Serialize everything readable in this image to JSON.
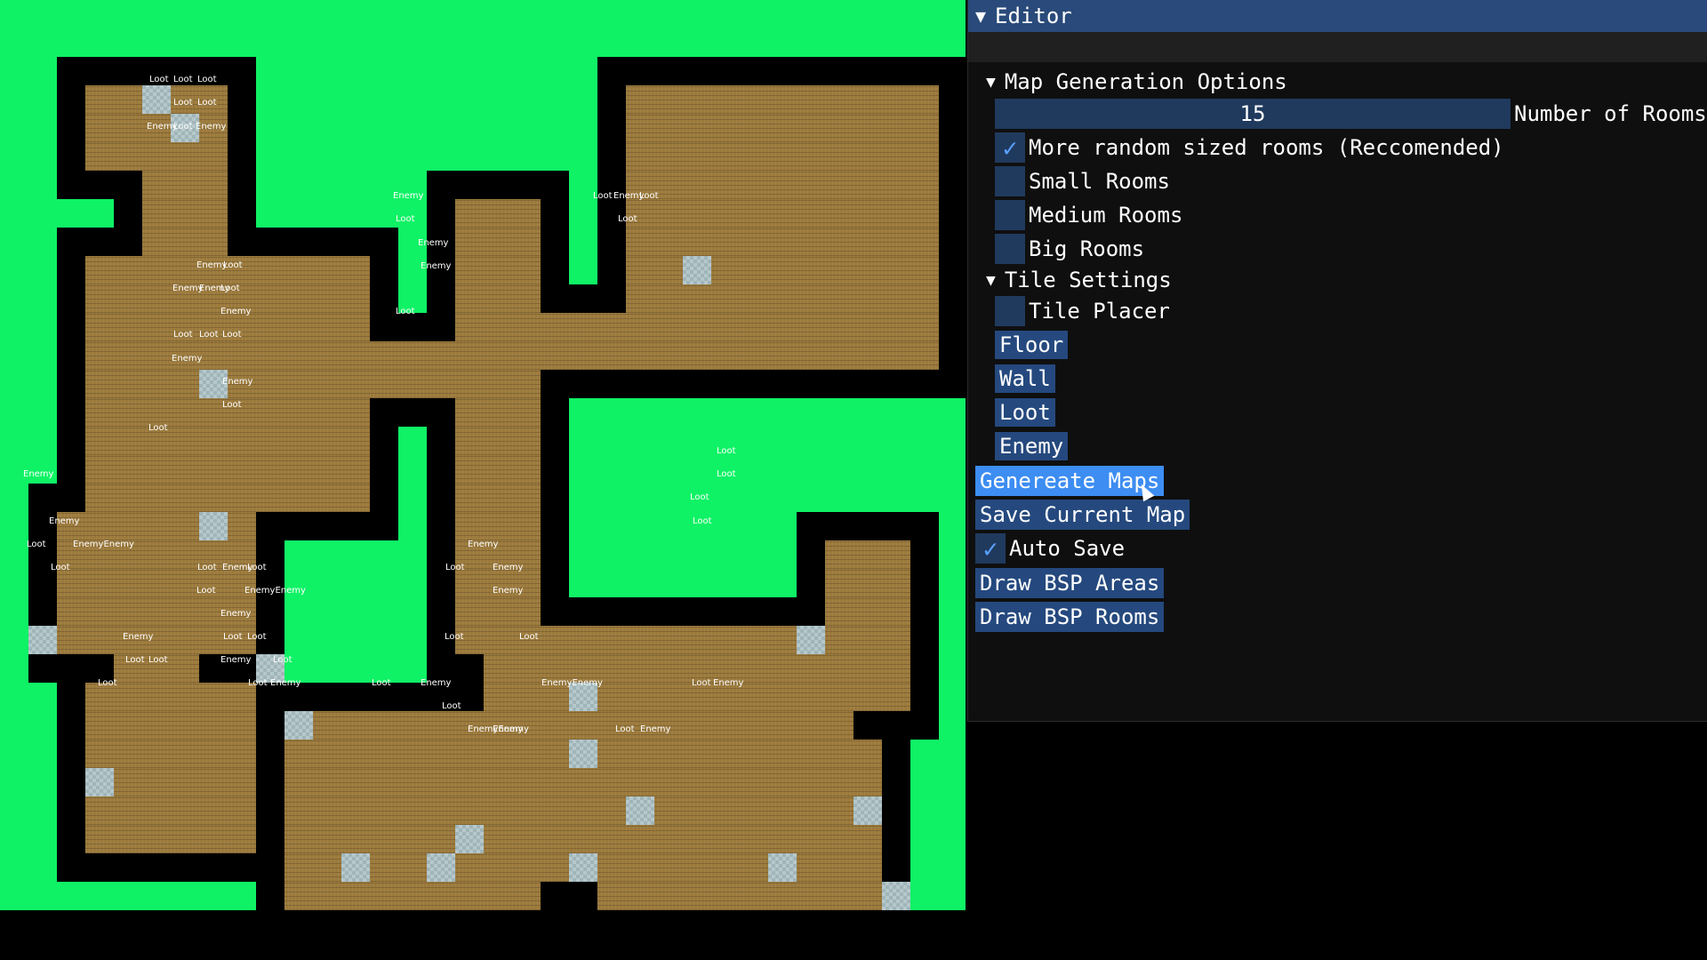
{
  "editor": {
    "title": "Editor",
    "map_generation_header": "Map Generation Options",
    "number_of_rooms_value": "15",
    "number_of_rooms_label": "Number of Rooms",
    "option_random_sized": {
      "label": "More random sized rooms (Reccomended)",
      "checked": true
    },
    "option_small_rooms": {
      "label": "Small Rooms",
      "checked": false
    },
    "option_medium_rooms": {
      "label": "Medium Rooms",
      "checked": false
    },
    "option_big_rooms": {
      "label": "Big Rooms",
      "checked": false
    },
    "tile_settings_header": "Tile Settings",
    "tile_placer": {
      "label": "Tile Placer",
      "checked": false
    },
    "tile_buttons": [
      "Floor",
      "Wall",
      "Loot",
      "Enemy"
    ],
    "generate_button": "Genereate Maps",
    "save_button": "Save Current Map",
    "auto_save": {
      "label": "Auto Save",
      "checked": true
    },
    "draw_bsp_areas_button": "Draw BSP Areas",
    "draw_bsp_rooms_button": "Draw BSP Rooms"
  },
  "map": {
    "labels": [
      "Loot",
      "Loot",
      "Loot",
      "Loot",
      "Loot",
      "Enemy",
      "Loot",
      "Enemy",
      "Enemy",
      "Loot",
      "Enemy",
      "Enemy",
      "Loot",
      "Enemy",
      "Loot",
      "Loot",
      "Enemy",
      "Loot",
      "Enemy",
      "Enemy",
      "Loot",
      "Enemy",
      "Loot",
      "Loot",
      "Loot",
      "Loot",
      "Enemy",
      "Enemy",
      "Loot",
      "Loot",
      "Loot",
      "Loot",
      "Loot",
      "Loot",
      "Enemy",
      "Loot",
      "Enemy",
      "EnemyEnemy",
      "Loot",
      "Loot",
      "Enemy",
      "Loot",
      "Enemy",
      "Loot",
      "Enemy",
      "Enemy",
      "Loot",
      "EnemyEnemy",
      "Enemy",
      "Loot",
      "Loot",
      "Enemy",
      "Loot",
      "Loot",
      "Enemy",
      "Loot",
      "Loot",
      "Loot",
      "Loot",
      "Enemy",
      "Loot",
      "Loot",
      "Enemy",
      "Loot",
      "EnemyEnemy",
      "Loot",
      "Enemy",
      "EnemyEnemy",
      "Enemy",
      "Loot",
      "Enemy",
      "Loot",
      "Enemy",
      "Loot"
    ]
  }
}
